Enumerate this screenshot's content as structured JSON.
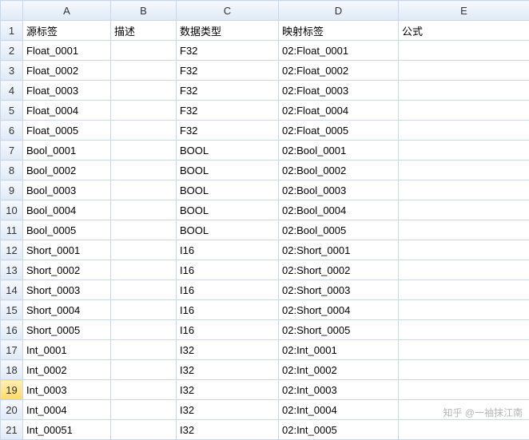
{
  "columns": [
    "A",
    "B",
    "C",
    "D",
    "E"
  ],
  "headers": {
    "A": "源标签",
    "B": "描述",
    "C": "数据类型",
    "D": "映射标签",
    "E": "公式"
  },
  "selected_row": 19,
  "rows": [
    {
      "n": 1,
      "A": "源标签",
      "B": "描述",
      "C": "数据类型",
      "D": "映射标签",
      "E": "公式"
    },
    {
      "n": 2,
      "A": "Float_0001",
      "B": "",
      "C": "F32",
      "D": "02:Float_0001",
      "E": ""
    },
    {
      "n": 3,
      "A": "Float_0002",
      "B": "",
      "C": "F32",
      "D": "02:Float_0002",
      "E": ""
    },
    {
      "n": 4,
      "A": "Float_0003",
      "B": "",
      "C": "F32",
      "D": "02:Float_0003",
      "E": ""
    },
    {
      "n": 5,
      "A": "Float_0004",
      "B": "",
      "C": "F32",
      "D": "02:Float_0004",
      "E": ""
    },
    {
      "n": 6,
      "A": "Float_0005",
      "B": "",
      "C": "F32",
      "D": "02:Float_0005",
      "E": ""
    },
    {
      "n": 7,
      "A": "Bool_0001",
      "B": "",
      "C": "BOOL",
      "D": "02:Bool_0001",
      "E": ""
    },
    {
      "n": 8,
      "A": "Bool_0002",
      "B": "",
      "C": "BOOL",
      "D": "02:Bool_0002",
      "E": ""
    },
    {
      "n": 9,
      "A": "Bool_0003",
      "B": "",
      "C": "BOOL",
      "D": "02:Bool_0003",
      "E": ""
    },
    {
      "n": 10,
      "A": "Bool_0004",
      "B": "",
      "C": "BOOL",
      "D": "02:Bool_0004",
      "E": ""
    },
    {
      "n": 11,
      "A": "Bool_0005",
      "B": "",
      "C": "BOOL",
      "D": "02:Bool_0005",
      "E": ""
    },
    {
      "n": 12,
      "A": "Short_0001",
      "B": "",
      "C": "I16",
      "D": "02:Short_0001",
      "E": ""
    },
    {
      "n": 13,
      "A": "Short_0002",
      "B": "",
      "C": "I16",
      "D": "02:Short_0002",
      "E": ""
    },
    {
      "n": 14,
      "A": "Short_0003",
      "B": "",
      "C": "I16",
      "D": "02:Short_0003",
      "E": ""
    },
    {
      "n": 15,
      "A": "Short_0004",
      "B": "",
      "C": "I16",
      "D": "02:Short_0004",
      "E": ""
    },
    {
      "n": 16,
      "A": "Short_0005",
      "B": "",
      "C": "I16",
      "D": "02:Short_0005",
      "E": ""
    },
    {
      "n": 17,
      "A": "Int_0001",
      "B": "",
      "C": "I32",
      "D": "02:Int_0001",
      "E": ""
    },
    {
      "n": 18,
      "A": "Int_0002",
      "B": "",
      "C": "I32",
      "D": "02:Int_0002",
      "E": ""
    },
    {
      "n": 19,
      "A": "Int_0003",
      "B": "",
      "C": "I32",
      "D": "02:Int_0003",
      "E": ""
    },
    {
      "n": 20,
      "A": "Int_0004",
      "B": "",
      "C": "I32",
      "D": "02:Int_0004",
      "E": ""
    },
    {
      "n": 21,
      "A": "Int_00051",
      "B": "",
      "C": "I32",
      "D": "02:Int_0005",
      "E": ""
    }
  ],
  "watermark": "知乎 @一袖抹江南"
}
